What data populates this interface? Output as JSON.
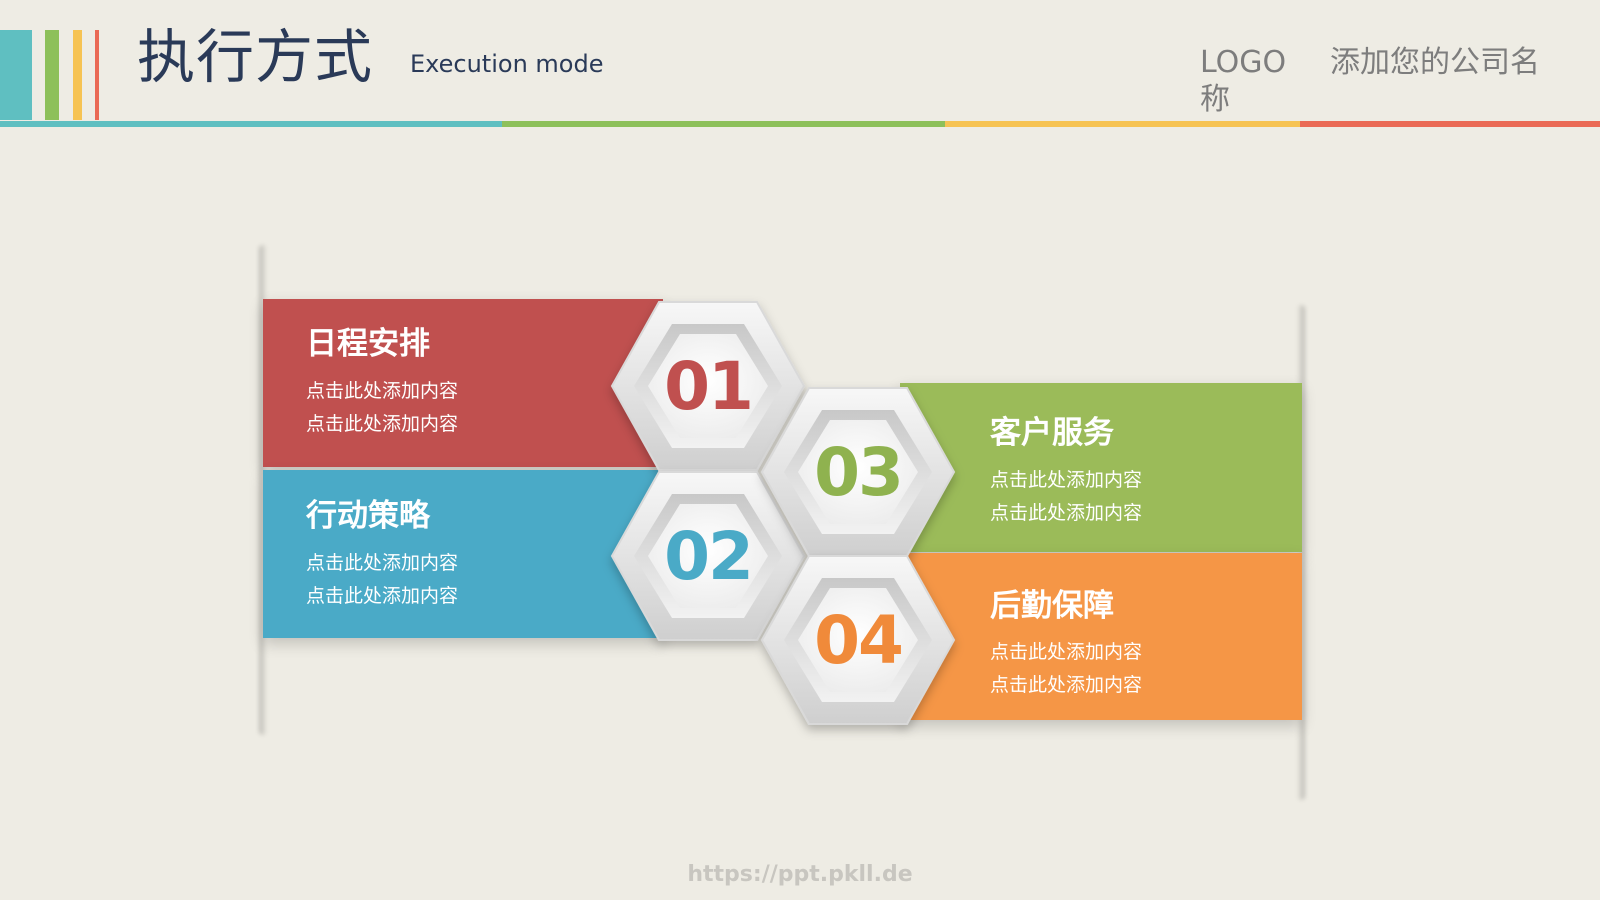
{
  "header": {
    "title": "执行方式",
    "subtitle": "Execution mode",
    "logo": "LOGO 称",
    "company": "添加您的公司名"
  },
  "colors": {
    "teal": "#5fbfc1",
    "green": "#8dc05a",
    "yellow": "#f6c353",
    "red": "#ea6a55",
    "band_red": "#c0504f",
    "band_blue": "#4aaac7",
    "band_green": "#9bbb59",
    "band_orange": "#f59646"
  },
  "steps": [
    {
      "number": "01",
      "title": "日程安排",
      "line1": "点击此处添加内容",
      "line2": "点击此处添加内容",
      "color": "#c0504f"
    },
    {
      "number": "02",
      "title": "行动策略",
      "line1": "点击此处添加内容",
      "line2": "点击此处添加内容",
      "color": "#4aaac7"
    },
    {
      "number": "03",
      "title": "客户服务",
      "line1": "点击此处添加内容",
      "line2": "点击此处添加内容",
      "color": "#9bbb59"
    },
    {
      "number": "04",
      "title": "后勤保障",
      "line1": "点击此处添加内容",
      "line2": "点击此处添加内容",
      "color": "#f59646"
    }
  ],
  "footer": {
    "url": "https://ppt.pkll.de"
  }
}
